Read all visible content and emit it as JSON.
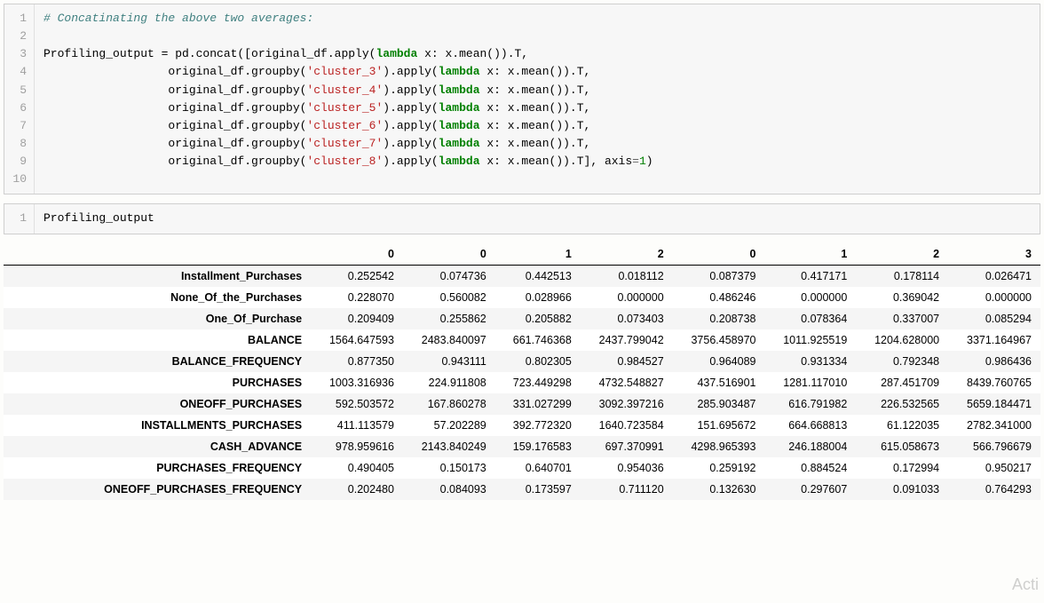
{
  "cell1": {
    "lines": [
      "1",
      "2",
      "3",
      "4",
      "5",
      "6",
      "7",
      "8",
      "9",
      "10"
    ],
    "comment": "# Concatinating the above two averages:",
    "var": "Profiling_output",
    "eq": " = ",
    "pd": "pd.concat([original_df.apply(",
    "lam": "lambda",
    "xmean": " x: x.mean()).T,",
    "indent": "                  original_df.groupby(",
    "c3": "'cluster_3'",
    "c4": "'cluster_4'",
    "c5": "'cluster_5'",
    "c6": "'cluster_6'",
    "c7": "'cluster_7'",
    "c8": "'cluster_8'",
    "apply": ").apply(",
    "xmeanT": " x: x.mean()).T,",
    "xmeanTend": " x: x.mean()).T], axis",
    "axiseq": "=",
    "one": "1",
    "close": ")"
  },
  "cell2": {
    "lines": [
      "1"
    ],
    "code": "Profiling_output"
  },
  "chart_data": {
    "type": "table",
    "columns": [
      "0",
      "0",
      "1",
      "2",
      "0",
      "1",
      "2",
      "3"
    ],
    "index": [
      "Installment_Purchases",
      "None_Of_the_Purchases",
      "One_Of_Purchase",
      "BALANCE",
      "BALANCE_FREQUENCY",
      "PURCHASES",
      "ONEOFF_PURCHASES",
      "INSTALLMENTS_PURCHASES",
      "CASH_ADVANCE",
      "PURCHASES_FREQUENCY",
      "ONEOFF_PURCHASES_FREQUENCY"
    ],
    "values": [
      [
        "0.252542",
        "0.074736",
        "0.442513",
        "0.018112",
        "0.087379",
        "0.417171",
        "0.178114",
        "0.026471"
      ],
      [
        "0.228070",
        "0.560082",
        "0.028966",
        "0.000000",
        "0.486246",
        "0.000000",
        "0.369042",
        "0.000000"
      ],
      [
        "0.209409",
        "0.255862",
        "0.205882",
        "0.073403",
        "0.208738",
        "0.078364",
        "0.337007",
        "0.085294"
      ],
      [
        "1564.647593",
        "2483.840097",
        "661.746368",
        "2437.799042",
        "3756.458970",
        "1011.925519",
        "1204.628000",
        "3371.164967"
      ],
      [
        "0.877350",
        "0.943111",
        "0.802305",
        "0.984527",
        "0.964089",
        "0.931334",
        "0.792348",
        "0.986436"
      ],
      [
        "1003.316936",
        "224.911808",
        "723.449298",
        "4732.548827",
        "437.516901",
        "1281.117010",
        "287.451709",
        "8439.760765"
      ],
      [
        "592.503572",
        "167.860278",
        "331.027299",
        "3092.397216",
        "285.903487",
        "616.791982",
        "226.532565",
        "5659.184471"
      ],
      [
        "411.113579",
        "57.202289",
        "392.772320",
        "1640.723584",
        "151.695672",
        "664.668813",
        "61.122035",
        "2782.341000"
      ],
      [
        "978.959616",
        "2143.840249",
        "159.176583",
        "697.370991",
        "4298.965393",
        "246.188004",
        "615.058673",
        "566.796679"
      ],
      [
        "0.490405",
        "0.150173",
        "0.640701",
        "0.954036",
        "0.259192",
        "0.884524",
        "0.172994",
        "0.950217"
      ],
      [
        "0.202480",
        "0.084093",
        "0.173597",
        "0.711120",
        "0.132630",
        "0.297607",
        "0.091033",
        "0.764293"
      ]
    ]
  },
  "watermark": "Acti"
}
